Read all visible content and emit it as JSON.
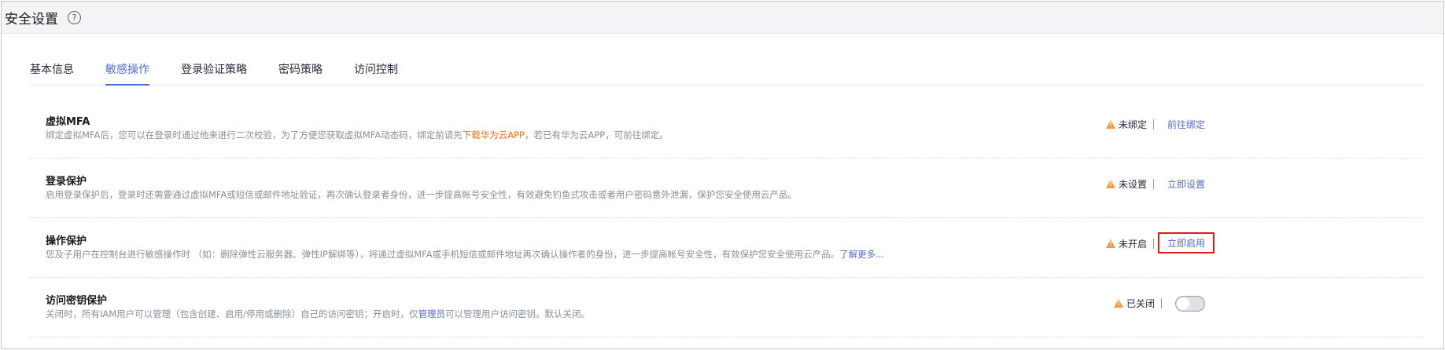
{
  "header": {
    "title": "安全设置",
    "help_icon": "?"
  },
  "tabs": [
    {
      "label": "基本信息",
      "active": false
    },
    {
      "label": "敏感操作",
      "active": true
    },
    {
      "label": "登录验证策略",
      "active": false
    },
    {
      "label": "密码策略",
      "active": false
    },
    {
      "label": "访问控制",
      "active": false
    }
  ],
  "rows": [
    {
      "title": "虚拟MFA",
      "desc_pre": "绑定虚拟MFA后，您可以在登录时通过他来进行二次校验，为了方便您获取虚拟MFA动态码，绑定前请先",
      "desc_link": "下载华为云APP，",
      "desc_post": "若已有华为云APP，可前往绑定。",
      "status": "未绑定",
      "action": "前往绑定"
    },
    {
      "title": "登录保护",
      "desc": "启用登录保护后，登录时还需要通过虚拟MFA或短信或邮件地址验证，再次确认登录者身份，进一步提高帐号安全性，有效避免钓鱼式攻击或者用户密码意外泄漏，保护您安全使用云产品。",
      "status": "未设置",
      "action": "立即设置"
    },
    {
      "title": "操作保护",
      "desc": "您及子用户在控制台进行敏感操作时 （如：删除弹性云服务器、弹性IP解绑等），将通过虚拟MFA或手机短信或邮件地址再次确认操作者的身份，进一步提高帐号安全性，有效保护您安全使用云产品。",
      "desc_link": "了解更多...",
      "status": "未开启",
      "action": "立即启用"
    },
    {
      "title": "访问密钥保护",
      "desc_pre": "关闭时，所有IAM用户可以管理（包含创建、启用/停用或删除）自己的访问密钥；开启时，仅",
      "desc_link": "管理员",
      "desc_post": "可以管理用户访问密钥。默认关闭。",
      "status": "已关闭",
      "toggle_on": false
    }
  ],
  "colors": {
    "accent": "#526ecc",
    "warning": "#fa9841",
    "highlight": "#e6191a",
    "orange_link": "#f66f0f"
  }
}
